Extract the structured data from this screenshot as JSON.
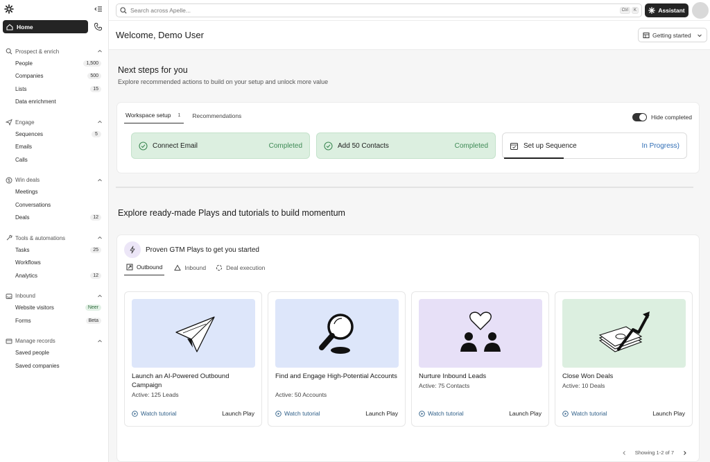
{
  "search": {
    "placeholder": "Search across Apelle...",
    "kbd1": "Ctrl",
    "kbd2": "K"
  },
  "header": {
    "assistant_label": "Assistant",
    "welcome": "Welcome, Demo User",
    "getting_started": "Getting started"
  },
  "sidebar": {
    "home": "Home",
    "sections": [
      {
        "title": "Prospect & enrich",
        "icon": "search-icon",
        "items": [
          {
            "label": "People",
            "badge": "1,500"
          },
          {
            "label": "Companies",
            "badge": "500"
          },
          {
            "label": "Lists",
            "badge": "15"
          },
          {
            "label": "Data enrichment",
            "badge": ""
          }
        ]
      },
      {
        "title": "Engage",
        "icon": "send-icon",
        "items": [
          {
            "label": "Sequences",
            "badge": "5"
          },
          {
            "label": "Emails",
            "badge": ""
          },
          {
            "label": "Calls",
            "badge": ""
          }
        ]
      },
      {
        "title": "Win deals",
        "icon": "dollar-icon",
        "items": [
          {
            "label": "Meetings",
            "badge": ""
          },
          {
            "label": "Conversations",
            "badge": ""
          },
          {
            "label": "Deals",
            "badge": "12"
          }
        ]
      },
      {
        "title": "Tools & automations",
        "icon": "tools-icon",
        "items": [
          {
            "label": "Tasks",
            "badge": "25"
          },
          {
            "label": "Workflows",
            "badge": ""
          },
          {
            "label": "Analytics",
            "badge": "12"
          }
        ]
      },
      {
        "title": "Inbound",
        "icon": "inbox-icon",
        "items": [
          {
            "label": "Website visitors",
            "badge": "Neer"
          },
          {
            "label": "Forms",
            "badge": "Beta"
          }
        ]
      },
      {
        "title": "Manage records",
        "icon": "records-icon",
        "items": [
          {
            "label": "Saved people",
            "badge": ""
          },
          {
            "label": "Saved companies",
            "badge": ""
          }
        ]
      }
    ]
  },
  "next_steps": {
    "title": "Next steps for you",
    "subtitle": "Explore recommended actions to build on your setup and unlock more value",
    "tab_setup": "Workspace setup",
    "tab_setup_count": "1",
    "tab_recs": "Recommendations",
    "hide_completed": "Hide completed",
    "steps": [
      {
        "label": "Connect Email",
        "status": "Completed"
      },
      {
        "label": "Add 50 Contacts",
        "status": "Completed"
      },
      {
        "label": "Set up Sequence",
        "status": "In Progress)"
      }
    ]
  },
  "explore": {
    "title": "Explore ready-made Plays and tutorials to build momentum",
    "plays_title": "Proven GTM Plays to get you started",
    "tabs": [
      "Outbound",
      "Inbound",
      "Deal execution"
    ],
    "cards": [
      {
        "title": "Launch an AI-Powered Outbound Campaign",
        "active": "Active: 125 Leads",
        "watch": "Watch tutorial",
        "launch": "Launch Play",
        "bg": "#dde6fa"
      },
      {
        "title": "Find and Engage High-Potential Accounts",
        "active": "Active: 50 Accounts",
        "watch": "Watch tutorial",
        "launch": "Launch Play",
        "bg": "#dde6fa"
      },
      {
        "title": "Nurture Inbound Leads",
        "active": "Active: 75 Contacts",
        "watch": "Watch tutorial",
        "launch": "Launch Play",
        "bg": "#e7e0f7"
      },
      {
        "title": "Close Won Deals",
        "active": "Active: 10 Deals",
        "watch": "Watch tutorial",
        "launch": "Launch Play",
        "bg": "#dcefe0"
      }
    ],
    "pager": "Showing 1-2 of 7"
  }
}
